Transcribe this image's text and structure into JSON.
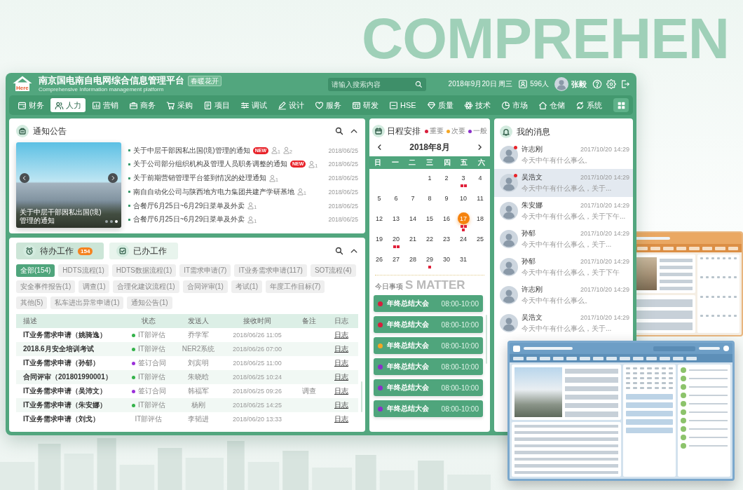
{
  "backdrop": {
    "headline": "COMPREHEN"
  },
  "header": {
    "logo_text": "Here",
    "title": "南京国电南自电网综合信息管理平台",
    "subtitle": "Comprehensive Information management platform",
    "theme_badge": "春暖花开",
    "search": {
      "placeholder": "请输入搜索内容"
    },
    "date": "2018年9月20日 周三",
    "online": "596人",
    "user": "张毅"
  },
  "nav": {
    "items": [
      {
        "label": "财务",
        "selected": false
      },
      {
        "label": "人力",
        "selected": true
      },
      {
        "label": "营销",
        "selected": false
      },
      {
        "label": "商务",
        "selected": false
      },
      {
        "label": "采购",
        "selected": false
      },
      {
        "label": "项目",
        "selected": false
      },
      {
        "label": "调试",
        "selected": false
      },
      {
        "label": "设计",
        "selected": false
      },
      {
        "label": "服务",
        "selected": false
      },
      {
        "label": "研发",
        "selected": false
      },
      {
        "label": "HSE",
        "selected": false
      },
      {
        "label": "质量",
        "selected": false
      },
      {
        "label": "技术",
        "selected": false
      },
      {
        "label": "市场",
        "selected": false
      },
      {
        "label": "仓储",
        "selected": false
      },
      {
        "label": "系统",
        "selected": false
      }
    ]
  },
  "notices": {
    "title": "通知公告",
    "carousel": {
      "caption": "关于中层干部因私出国(境)管理的通知",
      "slides": [
        {
          "selected": false
        },
        {
          "selected": false
        },
        {
          "selected": true
        }
      ]
    },
    "items": [
      {
        "title": "关于中层干部因私出国(境)管理的通知",
        "badge": "NEW",
        "readers": [
          "1",
          "2"
        ],
        "date": "2018/06/25"
      },
      {
        "title": "关于公司部分组织机构及管理人员职务调整的通知",
        "badge": "NEW",
        "readers": [
          "1"
        ],
        "date": "2018/06/25"
      },
      {
        "title": "关于前期营销管理平台签到情况的处理通知",
        "readers": [
          "1"
        ],
        "date": "2018/06/25"
      },
      {
        "title": "南自自动化公司与陕西地方电力集团共建产学研基地",
        "readers": [
          "1"
        ],
        "date": "2018/06/25"
      },
      {
        "title": "合餐厅6月25日~6月29日菜单及外卖",
        "readers": [
          "1"
        ],
        "date": "2018/06/25"
      },
      {
        "title": "合餐厅6月25日~6月29日菜单及外卖",
        "readers": [
          "1"
        ],
        "date": "2018/06/25"
      }
    ]
  },
  "tasks": {
    "tabs": [
      {
        "label": "待办工作",
        "badge": "154",
        "selected": true
      },
      {
        "label": "已办工作",
        "selected": false
      }
    ],
    "filters": [
      {
        "label": "全部(154)",
        "selected": true
      },
      {
        "label": "HDTS流程(1)",
        "selected": false
      },
      {
        "label": "HDTS数据流程(1)",
        "selected": false
      },
      {
        "label": "IT需求申请(7)",
        "selected": false
      },
      {
        "label": "IT业务需求申请(117)",
        "selected": false
      },
      {
        "label": "SOT流程(4)",
        "selected": false
      },
      {
        "label": "安全事件报告(1)",
        "selected": false
      },
      {
        "label": "调查(1)",
        "selected": false
      },
      {
        "label": "合理化建议流程(1)",
        "selected": false
      },
      {
        "label": "合同评审(1)",
        "selected": false
      },
      {
        "label": "考试(1)",
        "selected": false
      },
      {
        "label": "年度工作目标(7)",
        "selected": false
      },
      {
        "label": "其他(5)",
        "selected": false
      },
      {
        "label": "私车进出异常申请(1)",
        "selected": false
      },
      {
        "label": "通知公告(1)",
        "selected": false
      }
    ],
    "columns": [
      "描述",
      "状态",
      "发送人",
      "接收时间",
      "备注",
      "日志"
    ],
    "rows": [
      {
        "description": "IT业务需求申请（姚骑逸）",
        "status": "IT部评估",
        "color": "#33b24a",
        "sender": "乔学军",
        "received": "2018/06/26 11:05",
        "log": "日志"
      },
      {
        "description": "2018.6月安全培训考试",
        "status": "IT部评估",
        "color": "#33b24a",
        "sender": "NER2系统",
        "received": "2018/06/26 07:00",
        "log": "日志"
      },
      {
        "description": "IT业务需求申请（孙郁）",
        "status": "签订合同",
        "color": "#9b30d9",
        "sender": "刘宾明",
        "received": "2018/06/25 11:00",
        "log": "日志"
      },
      {
        "description": "合同评审（201801990001）",
        "status": "IT部评估",
        "color": "#33b24a",
        "sender": "朱晓晗",
        "received": "2018/06/25 10:24",
        "log": "日志"
      },
      {
        "description": "IT业务需求申请（吴沛文）",
        "status": "签订合同",
        "color": "#9b30d9",
        "sender": "韩福军",
        "received": "2018/06/25 09:26",
        "note": "调查",
        "log": "日志"
      },
      {
        "description": "IT业务需求申请（朱安娜）",
        "status": "IT部评估",
        "color": "#33b24a",
        "sender": "杨刚",
        "received": "2018/06/25 14:25",
        "log": "日志"
      },
      {
        "description": "IT业务需求申请（刘戈）",
        "status": "IT部评估",
        "sender": "李韬进",
        "received": "2018/06/20 13:33",
        "log": "日志"
      }
    ]
  },
  "schedule": {
    "title": "日程安排",
    "legend": [
      {
        "label": "重要",
        "color": "#d81e3c"
      },
      {
        "label": "次要",
        "color": "#f5a623"
      },
      {
        "label": "一般",
        "color": "#8b2fc9"
      }
    ],
    "month": "2018年8月",
    "weekdays": [
      "日",
      "一",
      "二",
      "三",
      "四",
      "五",
      "六"
    ],
    "weeks": [
      [
        {
          "kind": "blank"
        },
        {
          "kind": "blank"
        },
        {
          "kind": "blank"
        },
        {
          "kind": "day",
          "label": "1",
          "selected": false
        },
        {
          "kind": "day",
          "label": "2",
          "selected": false
        },
        {
          "kind": "day",
          "label": "3",
          "selected": false,
          "dots": [
            {
              "color": "#e0203a"
            },
            {
              "color": "#e0203a"
            }
          ]
        },
        {
          "kind": "day",
          "label": "4",
          "selected": false
        }
      ],
      [
        {
          "kind": "day",
          "label": "5",
          "selected": false
        },
        {
          "kind": "day",
          "label": "6",
          "selected": false
        },
        {
          "kind": "day",
          "label": "7",
          "selected": false
        },
        {
          "kind": "day",
          "label": "8",
          "selected": false
        },
        {
          "kind": "day",
          "label": "9",
          "selected": false
        },
        {
          "kind": "day",
          "label": "10",
          "selected": false
        },
        {
          "kind": "day",
          "label": "11",
          "selected": false
        }
      ],
      [
        {
          "kind": "day",
          "label": "12",
          "selected": false
        },
        {
          "kind": "day",
          "label": "13",
          "selected": false
        },
        {
          "kind": "day",
          "label": "14",
          "selected": false
        },
        {
          "kind": "day",
          "label": "15",
          "selected": false
        },
        {
          "kind": "day",
          "label": "16",
          "selected": false
        },
        {
          "kind": "day",
          "label": "17",
          "selected": true,
          "dots": [
            {
              "color": "#e0203a"
            },
            {
              "color": "#e0203a"
            },
            {
              "color": "#e0203a"
            }
          ]
        },
        {
          "kind": "day",
          "label": "18",
          "selected": false
        }
      ],
      [
        {
          "kind": "day",
          "label": "19",
          "selected": false
        },
        {
          "kind": "day",
          "label": "20",
          "selected": false,
          "dots": [
            {
              "color": "#e0203a"
            },
            {
              "color": "#e0203a"
            }
          ]
        },
        {
          "kind": "day",
          "label": "21",
          "selected": false
        },
        {
          "kind": "day",
          "label": "22",
          "selected": false
        },
        {
          "kind": "day",
          "label": "23",
          "selected": false
        },
        {
          "kind": "day",
          "label": "24",
          "selected": false
        },
        {
          "kind": "day",
          "label": "25",
          "selected": false
        }
      ],
      [
        {
          "kind": "day",
          "label": "26",
          "selected": false
        },
        {
          "kind": "day",
          "label": "27",
          "selected": false
        },
        {
          "kind": "day",
          "label": "28",
          "selected": false
        },
        {
          "kind": "day",
          "label": "29",
          "selected": false,
          "dots": [
            {
              "color": "#e0203a"
            }
          ]
        },
        {
          "kind": "day",
          "label": "30",
          "selected": false
        },
        {
          "kind": "day",
          "label": "31",
          "selected": false
        },
        {
          "kind": "blank"
        }
      ]
    ],
    "today_label": "今日事项",
    "today_watermark": "S MATTER",
    "events": [
      {
        "title": "年终总结大会",
        "time": "08:00-10:00",
        "color": "#d81e3c"
      },
      {
        "title": "年终总结大会",
        "time": "08:00-10:00",
        "color": "#d81e3c"
      },
      {
        "title": "年终总结大会",
        "time": "08:00-10:00",
        "color": "#f5a623"
      },
      {
        "title": "年终总结大会",
        "time": "08:00-10:00",
        "color": "#8b2fc9"
      },
      {
        "title": "年终总结大会",
        "time": "08:00-10:00",
        "color": "#8b2fc9"
      },
      {
        "title": "年终总结大会",
        "time": "08:00-10:00",
        "color": "#8b2fc9"
      }
    ]
  },
  "messages": {
    "title": "我的消息",
    "items": [
      {
        "name": "许志刚",
        "time": "2017/10/20 14:29",
        "preview": "今天中午有什么事么。",
        "unread": true,
        "selected": false
      },
      {
        "name": "吴浩文",
        "time": "2017/10/20 14:29",
        "preview": "今天中午有什么事么，关于...",
        "unread": true,
        "selected": true
      },
      {
        "name": "朱安娜",
        "time": "2017/10/20 14:29",
        "preview": "今天中午有什么事么，关于下午...",
        "unread": false,
        "selected": false
      },
      {
        "name": "孙郁",
        "time": "2017/10/20 14:29",
        "preview": "今天中午有什么事么，关于...",
        "unread": false,
        "selected": false
      },
      {
        "name": "孙郁",
        "time": "2017/10/20 14:29",
        "preview": "今天中午有什么事么，关于下午",
        "unread": false,
        "selected": false
      },
      {
        "name": "许志刚",
        "time": "2017/10/20 14:29",
        "preview": "今天中午有什么事么。",
        "unread": false,
        "selected": false
      },
      {
        "name": "吴浩文",
        "time": "2017/10/20 14:29",
        "preview": "今天中午有什么事么，关于...",
        "unread": false,
        "selected": false
      }
    ]
  }
}
